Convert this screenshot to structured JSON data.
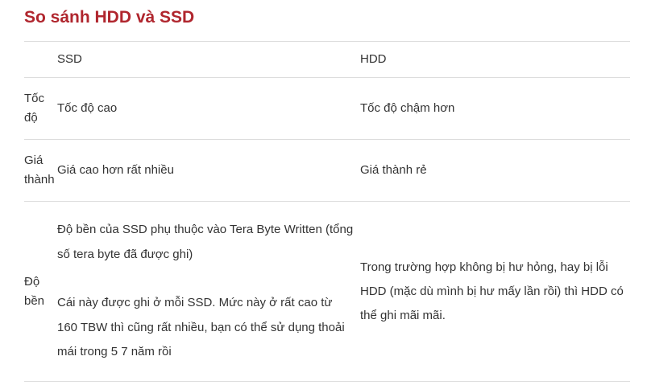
{
  "page": {
    "title": "So sánh HDD và SSD",
    "title_color": "#b0262e"
  },
  "table": {
    "header": {
      "label": "",
      "ssd": "SSD",
      "hdd": "HDD"
    },
    "rows": [
      {
        "label": "Tốc độ",
        "ssd": [
          "Tốc độ cao"
        ],
        "hdd": "Tốc độ chậm hơn"
      },
      {
        "label": "Giá thành",
        "ssd": [
          "Giá cao hơn rất nhiều"
        ],
        "hdd": "Giá thành rẻ"
      },
      {
        "label": "Độ bền",
        "ssd": [
          "Độ bền của SSD phụ thuộc vào Tera Byte Written (tổng số tera byte đã được ghi)",
          "Cái này được ghi ở mỗi SSD. Mức này ở rất cao từ 160 TBW thì cũng rất nhiều, bạn có thể sử dụng thoải mái trong 5 7 năm rồi"
        ],
        "hdd": "Trong trường hợp không bị hư hỏng, hay bị lỗi HDD (mặc dù mình bị hư mấy lần rồi) thì HDD có thể ghi mãi mãi."
      }
    ]
  }
}
